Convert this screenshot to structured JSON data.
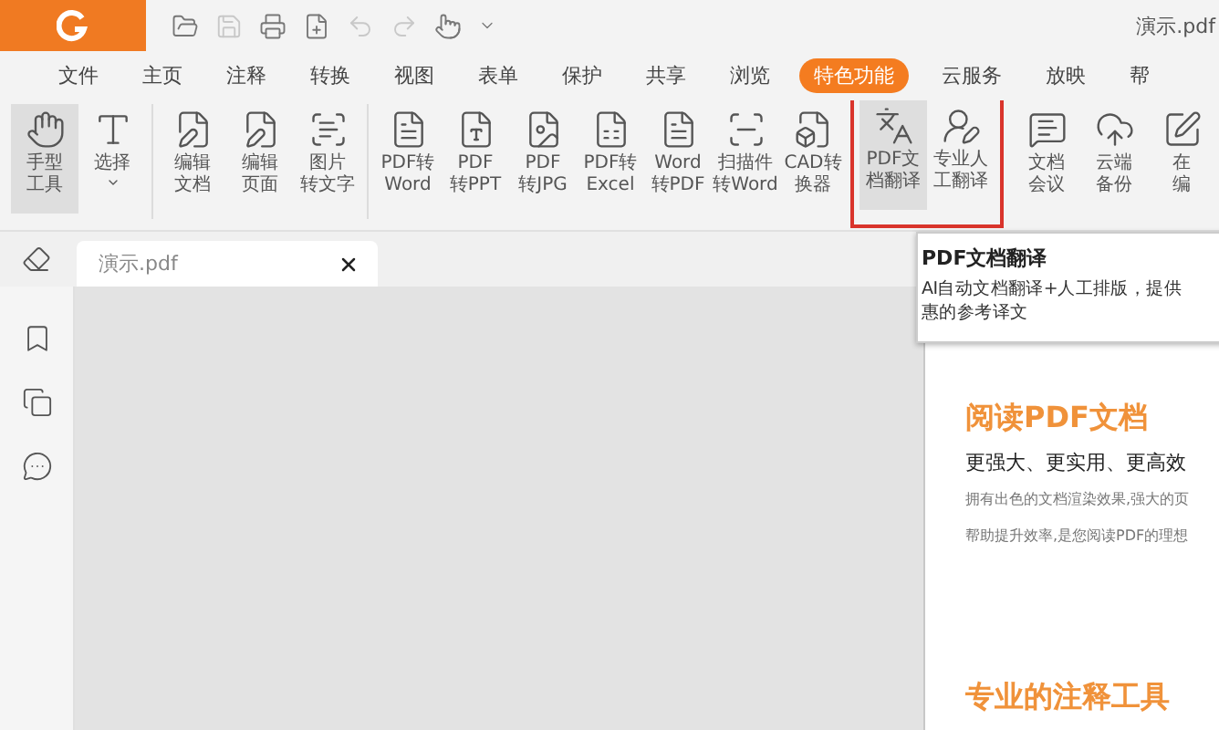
{
  "window": {
    "title": "演示.pdf"
  },
  "quick_access": [
    {
      "disabled": false
    },
    {
      "disabled": true
    },
    {
      "disabled": false
    },
    {
      "disabled": false
    },
    {
      "disabled": true
    },
    {
      "disabled": true
    },
    {
      "disabled": false
    },
    {
      "disabled": false
    }
  ],
  "menu": [
    {
      "label": "文件",
      "selected": false
    },
    {
      "label": "主页",
      "selected": false
    },
    {
      "label": "注释",
      "selected": false
    },
    {
      "label": "转换",
      "selected": false
    },
    {
      "label": "视图",
      "selected": false
    },
    {
      "label": "表单",
      "selected": false
    },
    {
      "label": "保护",
      "selected": false
    },
    {
      "label": "共享",
      "selected": false
    },
    {
      "label": "浏览",
      "selected": false
    },
    {
      "label": "特色功能",
      "selected": true
    },
    {
      "label": "云服务",
      "selected": false
    },
    {
      "label": "放映",
      "selected": false
    },
    {
      "label": "帮",
      "selected": false
    }
  ],
  "ribbon": {
    "groups": [
      {
        "highlighted": false,
        "items": [
          {
            "kind": "button",
            "lines": [
              "手型",
              "工具"
            ],
            "selected": true
          },
          {
            "kind": "dropdown",
            "lines": [
              "选择"
            ],
            "selected": false
          }
        ]
      },
      {
        "highlighted": false,
        "items": [
          {
            "kind": "button",
            "lines": [
              "编辑",
              "文档"
            ],
            "selected": false
          },
          {
            "kind": "button",
            "lines": [
              "编辑",
              "页面"
            ],
            "selected": false
          },
          {
            "kind": "button",
            "lines": [
              "图片",
              "转文字"
            ],
            "selected": false
          }
        ]
      },
      {
        "highlighted": false,
        "items": [
          {
            "kind": "button",
            "lines": [
              "PDF转",
              "Word"
            ],
            "selected": false
          },
          {
            "kind": "button",
            "lines": [
              "PDF",
              "转PPT"
            ],
            "selected": false
          },
          {
            "kind": "button",
            "lines": [
              "PDF",
              "转JPG"
            ],
            "selected": false
          },
          {
            "kind": "button",
            "lines": [
              "PDF转",
              "Excel"
            ],
            "selected": false
          },
          {
            "kind": "button",
            "lines": [
              "Word",
              "转PDF"
            ],
            "selected": false
          },
          {
            "kind": "button",
            "lines": [
              "扫描件",
              "转Word"
            ],
            "selected": false
          },
          {
            "kind": "button",
            "lines": [
              "CAD转",
              "换器"
            ],
            "selected": false
          }
        ]
      },
      {
        "highlighted": true,
        "items": [
          {
            "kind": "button",
            "lines": [
              "PDF文",
              "档翻译"
            ],
            "selected": true
          },
          {
            "kind": "button",
            "lines": [
              "专业人",
              "工翻译"
            ],
            "selected": false
          }
        ]
      },
      {
        "highlighted": false,
        "items": [
          {
            "kind": "button",
            "lines": [
              "文档",
              "会议"
            ],
            "selected": false
          },
          {
            "kind": "button",
            "lines": [
              "云端",
              "备份"
            ],
            "selected": false
          },
          {
            "kind": "button",
            "lines": [
              "在",
              "编"
            ],
            "selected": false
          }
        ]
      }
    ]
  },
  "tooltip": {
    "title": "PDF文档翻译",
    "lines": [
      "AI自动文档翻译+人工排版，提供",
      "惠的参考译文"
    ]
  },
  "document_tab": {
    "title": "演示.pdf"
  },
  "page": {
    "heading": "阅读PDF文档",
    "subheading": "更强大、更实用、更高效",
    "lines": [
      "拥有出色的文档渲染效果,强大的页",
      "帮助提升效率,是您阅读PDF的理想"
    ],
    "next_heading": "专业的注释工具"
  }
}
